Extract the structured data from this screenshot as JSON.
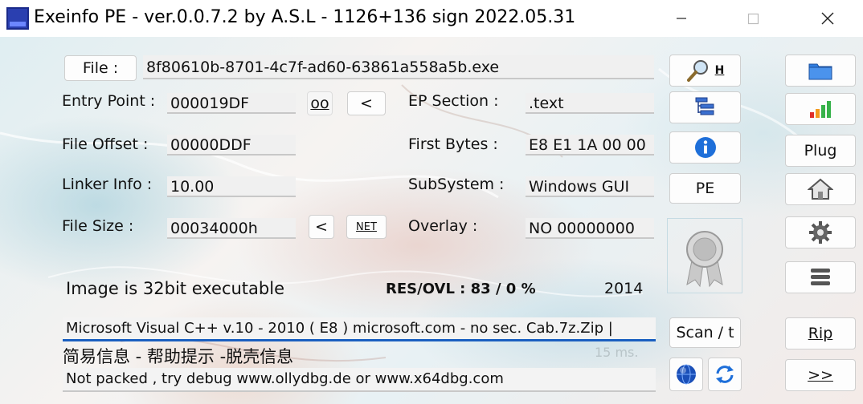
{
  "window": {
    "title": "Exeinfo PE - ver.0.0.7.2  by A.S.L -  1126+136 sign  2022.05.31",
    "minimize_glyph": "─",
    "maximize_glyph": "☐",
    "close_glyph": "✕"
  },
  "file": {
    "button_label": "File :",
    "path": "8f80610b-8701-4c7f-ad60-63861a558a5b.exe"
  },
  "fields": {
    "entry_point_label": "Entry Point :",
    "entry_point_value": "000019DF",
    "oo_button": "oo",
    "lt_button_1": "<",
    "file_offset_label": "File Offset :",
    "file_offset_value": "00000DDF",
    "linker_info_label": "Linker Info :",
    "linker_info_value": "10.00",
    "file_size_label": "File Size :",
    "file_size_value": "00034000h",
    "lt_button_2": "<",
    "net_button": "NET",
    "ep_section_label": "EP Section :",
    "ep_section_value": ".text",
    "first_bytes_label": "First Bytes :",
    "first_bytes_value": "E8 E1 1A 00 00",
    "subsystem_label": "SubSystem :",
    "subsystem_value": "Windows GUI",
    "overlay_label": "Overlay :",
    "overlay_value": "NO   00000000"
  },
  "info": {
    "image_bits": "Image is 32bit executable",
    "res_ovl": "RES/OVL : 83 / 0 %",
    "year": "2014",
    "detection": "Microsoft Visual C++ v.10 - 2010 ( E8 ) microsoft.com - no sec. Cab.7z.Zip |",
    "chinese_links": "简易信息 - 帮助提示 -脱壳信息",
    "time": "15 ms.",
    "hint": "Not packed , try  debug www.ollydbg.de or www.x64dbg.com"
  },
  "middle_buttons": {
    "search_h": "H",
    "pe": "PE",
    "scan": "Scan / t"
  },
  "right_buttons": {
    "plug": "Plug",
    "rip": "Rip",
    "next": ">>"
  },
  "colors": {
    "accent_blue": "#1e6fd9",
    "detection_underline": "#1a5fc0",
    "folder_blue": "#2f7de0",
    "bar_red": "#e0302a",
    "bar_orange": "#f29a1e",
    "bar_green": "#37b24a"
  },
  "icons": {
    "app": "exeinfo-app-icon",
    "search": "magnifier-icon",
    "tree": "tree-list-icon",
    "info": "info-icon",
    "award": "award-ribbon-icon",
    "globe": "globe-icon",
    "refresh": "refresh-arrows-icon",
    "folder": "folder-icon",
    "stats": "signal-bars-icon",
    "home": "home-icon",
    "settings": "gear-icon",
    "menu": "stack-menu-icon"
  }
}
